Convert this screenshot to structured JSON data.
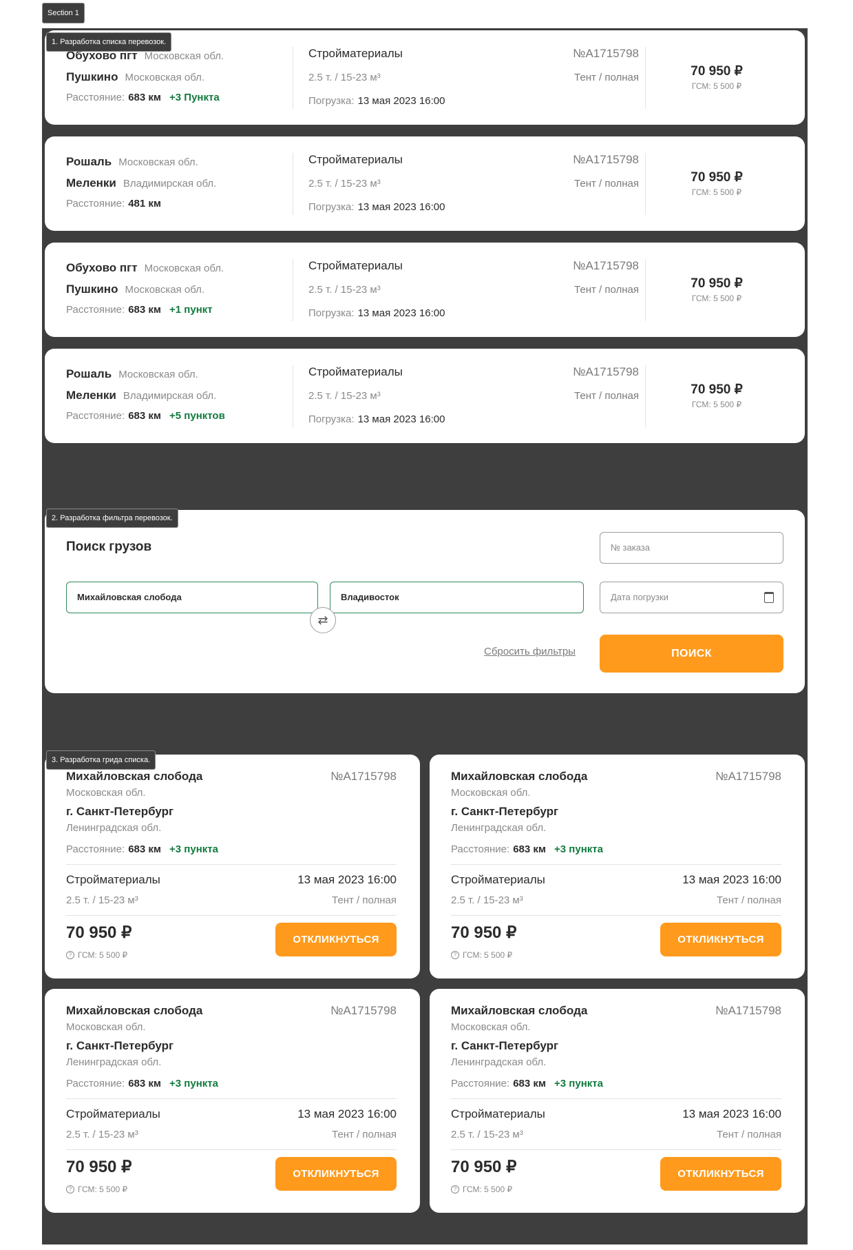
{
  "section_label": "Section 1",
  "list": {
    "caption": "1. Разработка списка перевозок.",
    "rows": [
      {
        "from": {
          "city": "Обухово пгт",
          "region": "Московская обл."
        },
        "to": {
          "city": "Пушкино",
          "region": "Московская обл."
        },
        "distance_label": "Расстояние:",
        "distance": "683 км",
        "extra_points": "+3 Пункта",
        "cargo": "Стройматериалы",
        "order_no": "№А1715798",
        "weight": "2.5 т. / 15-23 м³",
        "body": "Тент / полная",
        "loading_label": "Погрузка:",
        "loading_date": "13 мая 2023 16:00",
        "price": "70 950 ₽",
        "fuel": "ГСМ: 5 500 ₽"
      },
      {
        "from": {
          "city": "Рошаль",
          "region": "Московская обл."
        },
        "to": {
          "city": "Меленки",
          "region": "Владимирская обл."
        },
        "distance_label": "Расстояние:",
        "distance": "481 км",
        "extra_points": "",
        "cargo": "Стройматериалы",
        "order_no": "№А1715798",
        "weight": "2.5 т. / 15-23 м³",
        "body": "Тент / полная",
        "loading_label": "Погрузка:",
        "loading_date": "13 мая 2023 16:00",
        "price": "70 950 ₽",
        "fuel": "ГСМ: 5 500 ₽"
      },
      {
        "from": {
          "city": "Обухово пгт",
          "region": "Московская обл."
        },
        "to": {
          "city": "Пушкино",
          "region": "Московская обл."
        },
        "distance_label": "Расстояние:",
        "distance": "683 км",
        "extra_points": "+1 пункт",
        "cargo": "Стройматериалы",
        "order_no": "№А1715798",
        "weight": "2.5 т. / 15-23 м³",
        "body": "Тент / полная",
        "loading_label": "Погрузка:",
        "loading_date": "13 мая 2023 16:00",
        "price": "70 950 ₽",
        "fuel": "ГСМ: 5 500 ₽"
      },
      {
        "from": {
          "city": "Рошаль",
          "region": "Московская обл."
        },
        "to": {
          "city": "Меленки",
          "region": "Владимирская обл."
        },
        "distance_label": "Расстояние:",
        "distance": "683 км",
        "extra_points": "+5 пунктов",
        "cargo": "Стройматериалы",
        "order_no": "№А1715798",
        "weight": "2.5 т. / 15-23 м³",
        "body": "Тент / полная",
        "loading_label": "Погрузка:",
        "loading_date": "13 мая 2023 16:00",
        "price": "70 950 ₽",
        "fuel": "ГСМ: 5 500 ₽"
      }
    ]
  },
  "filter": {
    "caption": "2. Разработка фильтра перевозок.",
    "title": "Поиск грузов",
    "order_placeholder": "№ заказа",
    "from_value": "Михайловская слобода",
    "to_value": "Владивосток",
    "date_placeholder": "Дата погрузки",
    "reset_label": "Сбросить фильтры",
    "search_label": "ПОИСК"
  },
  "grid": {
    "caption": "3. Разработка грида списка.",
    "cards": [
      {
        "from_city": "Михайловская слобода",
        "from_region": "Московская обл.",
        "to_city": "г. Санкт-Петербург",
        "to_region": "Ленинградская обл.",
        "order_no": "№А1715798",
        "distance_label": "Расстояние:",
        "distance": "683 км",
        "extra_points": "+3 пункта",
        "cargo": "Стройматериалы",
        "date": "13 мая 2023 16:00",
        "weight": "2.5 т. / 15-23 м³",
        "body": "Тент / полная",
        "price": "70 950 ₽",
        "fuel": "ГСМ: 5 500 ₽",
        "button": "ОТКЛИКНУТЬСЯ"
      },
      {
        "from_city": "Михайловская слобода",
        "from_region": "Московская обл.",
        "to_city": "г. Санкт-Петербург",
        "to_region": "Ленинградская обл.",
        "order_no": "№А1715798",
        "distance_label": "Расстояние:",
        "distance": "683 км",
        "extra_points": "+3 пункта",
        "cargo": "Стройматериалы",
        "date": "13 мая 2023 16:00",
        "weight": "2.5 т. / 15-23 м³",
        "body": "Тент / полная",
        "price": "70 950 ₽",
        "fuel": "ГСМ: 5 500 ₽",
        "button": "ОТКЛИКНУТЬСЯ"
      },
      {
        "from_city": "Михайловская слобода",
        "from_region": "Московская обл.",
        "to_city": "г. Санкт-Петербург",
        "to_region": "Ленинградская обл.",
        "order_no": "№А1715798",
        "distance_label": "Расстояние:",
        "distance": "683 км",
        "extra_points": "+3 пункта",
        "cargo": "Стройматериалы",
        "date": "13 мая 2023 16:00",
        "weight": "2.5 т. / 15-23 м³",
        "body": "Тент / полная",
        "price": "70 950 ₽",
        "fuel": "ГСМ: 5 500 ₽",
        "button": "ОТКЛИКНУТЬСЯ"
      },
      {
        "from_city": "Михайловская слобода",
        "from_region": "Московская обл.",
        "to_city": "г. Санкт-Петербург",
        "to_region": "Ленинградская обл.",
        "order_no": "№А1715798",
        "distance_label": "Расстояние:",
        "distance": "683 км",
        "extra_points": "+3 пункта",
        "cargo": "Стройматериалы",
        "date": "13 мая 2023 16:00",
        "weight": "2.5 т. / 15-23 м³",
        "body": "Тент / полная",
        "price": "70 950 ₽",
        "fuel": "ГСМ: 5 500 ₽",
        "button": "ОТКЛИКНУТЬСЯ"
      }
    ]
  },
  "colors": {
    "accent": "#ff9a1c",
    "green": "#127a3e",
    "canvas": "#3e3e3e"
  },
  "icons": {
    "swap": "swap-arrows-icon",
    "calendar": "calendar-icon",
    "help": "question-circle-icon"
  }
}
